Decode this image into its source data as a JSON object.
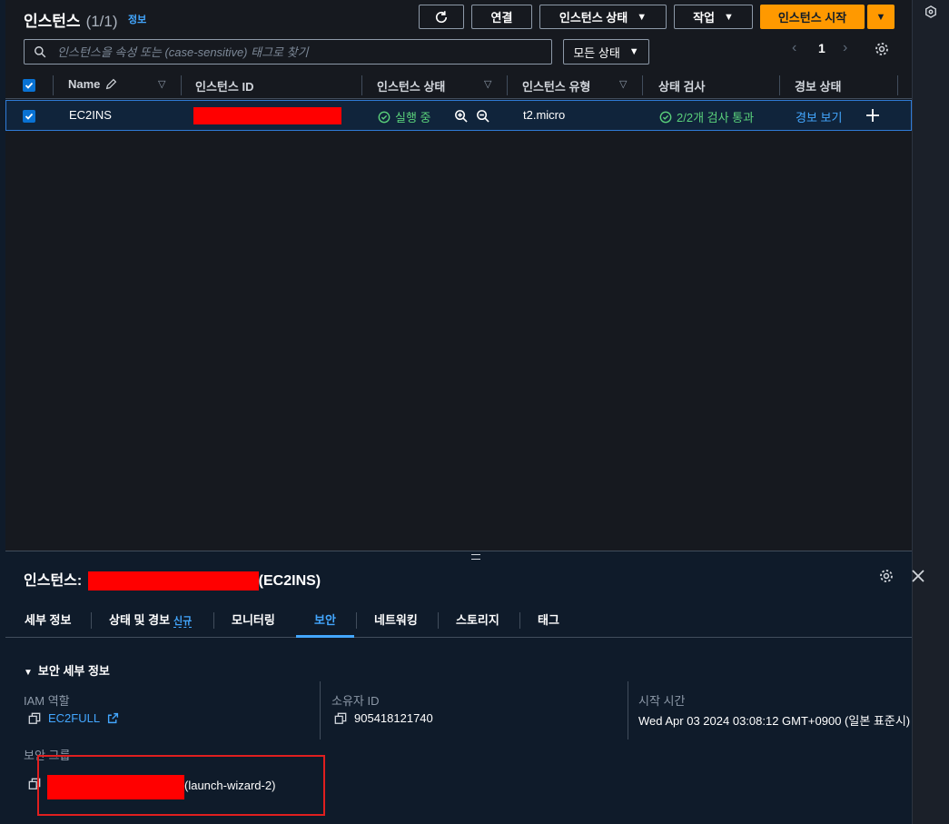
{
  "header": {
    "title": "인스턴스",
    "count": "(1/1)",
    "info_link": "정보",
    "connect_label": "연결",
    "instance_state_label": "인스턴스 상태",
    "actions_label": "작업",
    "launch_label": "인스턴스 시작"
  },
  "search": {
    "placeholder": "인스턴스을 속성 또는 (case-sensitive) 태그로 찾기",
    "state_filter": "모든 상태"
  },
  "pagination": {
    "current_page": "1"
  },
  "table": {
    "columns": [
      "Name",
      "인스턴스 ID",
      "인스턴스 상태",
      "인스턴스 유형",
      "상태 검사",
      "경보 상태"
    ],
    "rows": [
      {
        "name": "EC2INS",
        "instance_id": "",
        "state": "실행 중",
        "type": "t2.micro",
        "status_check": "2/2개 검사 통과",
        "alarm": "경보 보기",
        "selected": true
      }
    ]
  },
  "details": {
    "title_prefix": "인스턴스:",
    "title_suffix": "(EC2INS)",
    "tabs": [
      "세부 정보",
      "상태 및 경보",
      "모니터링",
      "보안",
      "네트워킹",
      "스토리지",
      "태그"
    ],
    "new_badge": "신규",
    "active_tab": "보안",
    "section_title": "보안 세부 정보",
    "iam_role_label": "IAM 역할",
    "iam_role_value": "EC2FULL",
    "owner_id_label": "소유자 ID",
    "owner_id_value": "905418121740",
    "launch_time_label": "시작 시간",
    "launch_time_value": "Wed Apr 03 2024 03:08:12 GMT+0900 (일본 표준시)",
    "security_groups_label": "보안 그룹",
    "security_group_suffix": "(launch-wizard-2)"
  },
  "colors": {
    "accent": "#43a7ff",
    "primary_button": "#ff9900",
    "success": "#5ad17b",
    "redaction": "#ff0000",
    "highlight_border": "#e01f1f"
  }
}
